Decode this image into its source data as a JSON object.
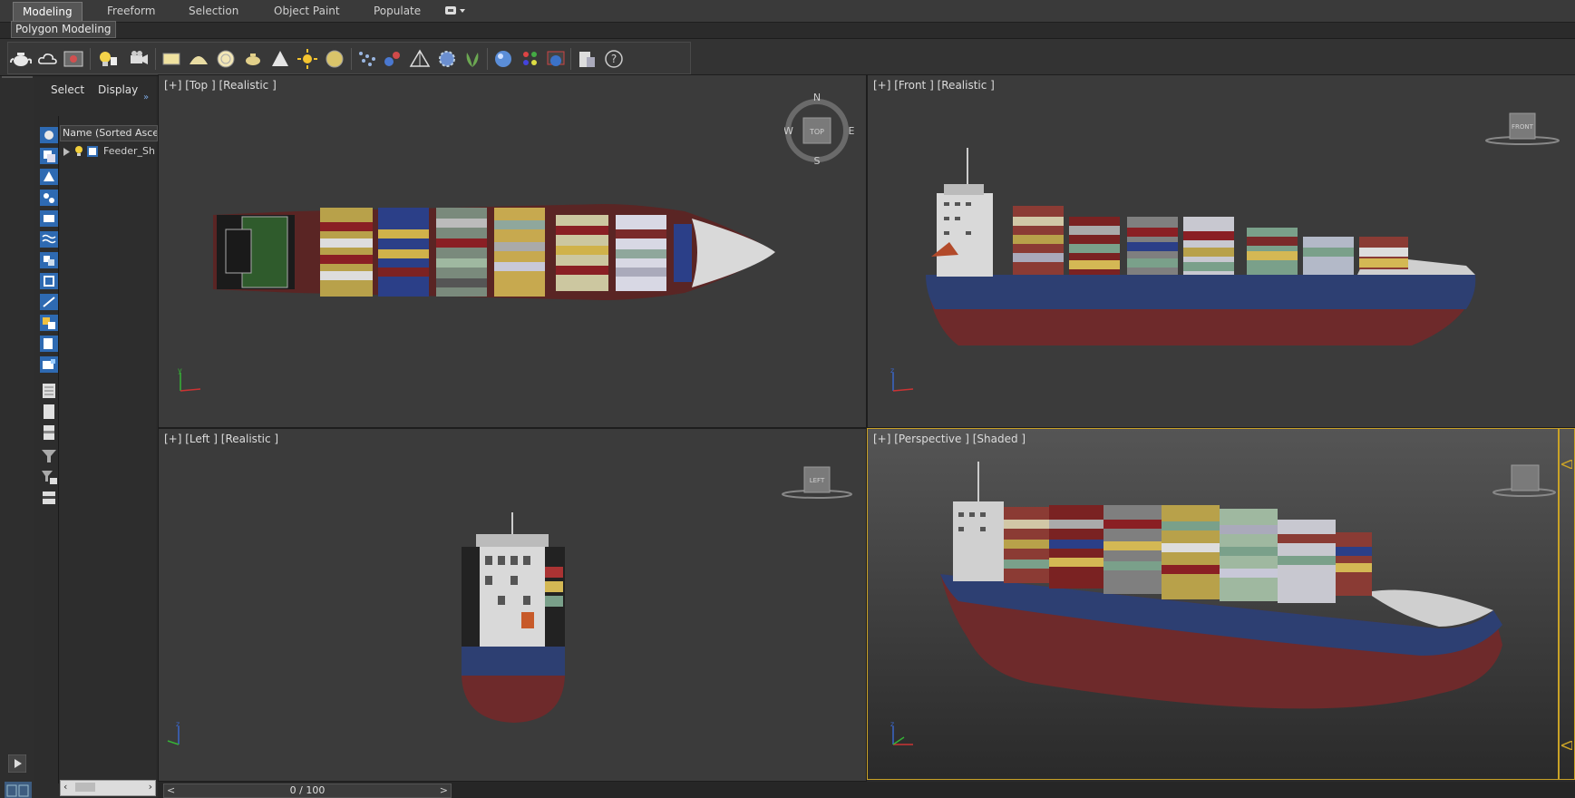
{
  "ribbon": {
    "tabs": [
      {
        "label": "Modeling",
        "active": true
      },
      {
        "label": "Freeform",
        "active": false
      },
      {
        "label": "Selection",
        "active": false
      },
      {
        "label": "Object Paint",
        "active": false
      },
      {
        "label": "Populate",
        "active": false
      }
    ],
    "subtab": "Polygon Modeling"
  },
  "toolbar": {
    "icons": [
      "teapot-icon",
      "cloud-icon",
      "render-frame-icon",
      "light-icon",
      "camera-icon",
      "plane-icon",
      "dome-icon",
      "sphere-icon",
      "teapot-small-icon",
      "cone-icon",
      "sun-icon",
      "disc-icon",
      "particles-icon",
      "molecule-icon",
      "tetra-icon",
      "gear-sphere-icon",
      "plant-icon",
      "material-sphere-icon",
      "material-palette-icon",
      "render-setup-icon",
      "clipboard-icon",
      "help-icon"
    ]
  },
  "explorer": {
    "menu": {
      "select": "Select",
      "display": "Display"
    },
    "column_header": "Name (Sorted Ascending)",
    "rows": [
      {
        "name": "Feeder_Ship"
      }
    ]
  },
  "viewports": {
    "top": {
      "label": "[+] [Top ] [Realistic ]",
      "cube": "TOP",
      "compass": {
        "n": "N",
        "s": "S",
        "e": "E",
        "w": "W"
      }
    },
    "front": {
      "label": "[+] [Front ] [Realistic ]",
      "cube": "FRONT"
    },
    "left": {
      "label": "[+] [Left ] [Realistic ]",
      "cube": "LEFT"
    },
    "perspective": {
      "label": "[+] [Perspective ] [Shaded ]"
    }
  },
  "axis": {
    "x": "x",
    "y": "y",
    "z": "z"
  },
  "timeline": {
    "frame_label": "0 / 100"
  },
  "colors": {
    "hull_red": "#6e2a2b",
    "hull_blue": "#2d3f72",
    "active_border": "#c9a227"
  }
}
